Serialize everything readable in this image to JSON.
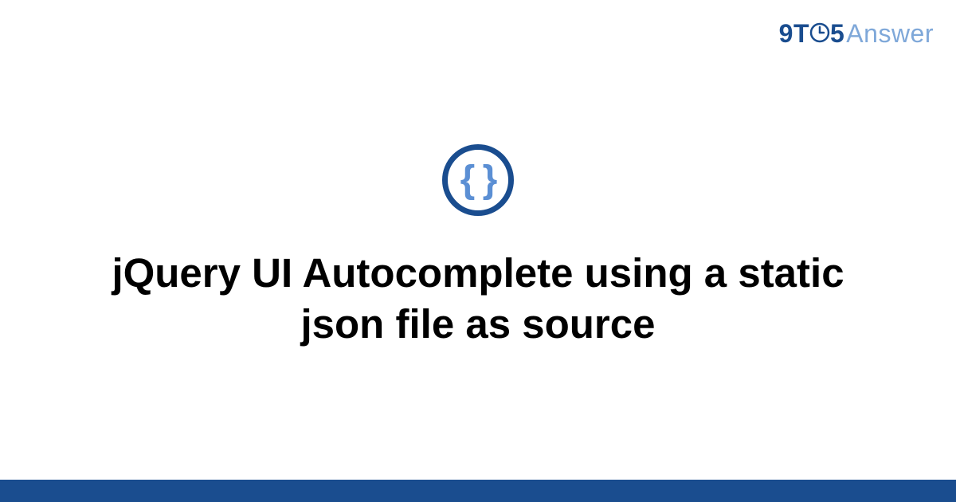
{
  "logo": {
    "prefix": "9T",
    "middle": "5",
    "suffix": "Answer"
  },
  "icon": {
    "braces": "{ }"
  },
  "title": "jQuery UI Autocomplete using a static json file as source"
}
